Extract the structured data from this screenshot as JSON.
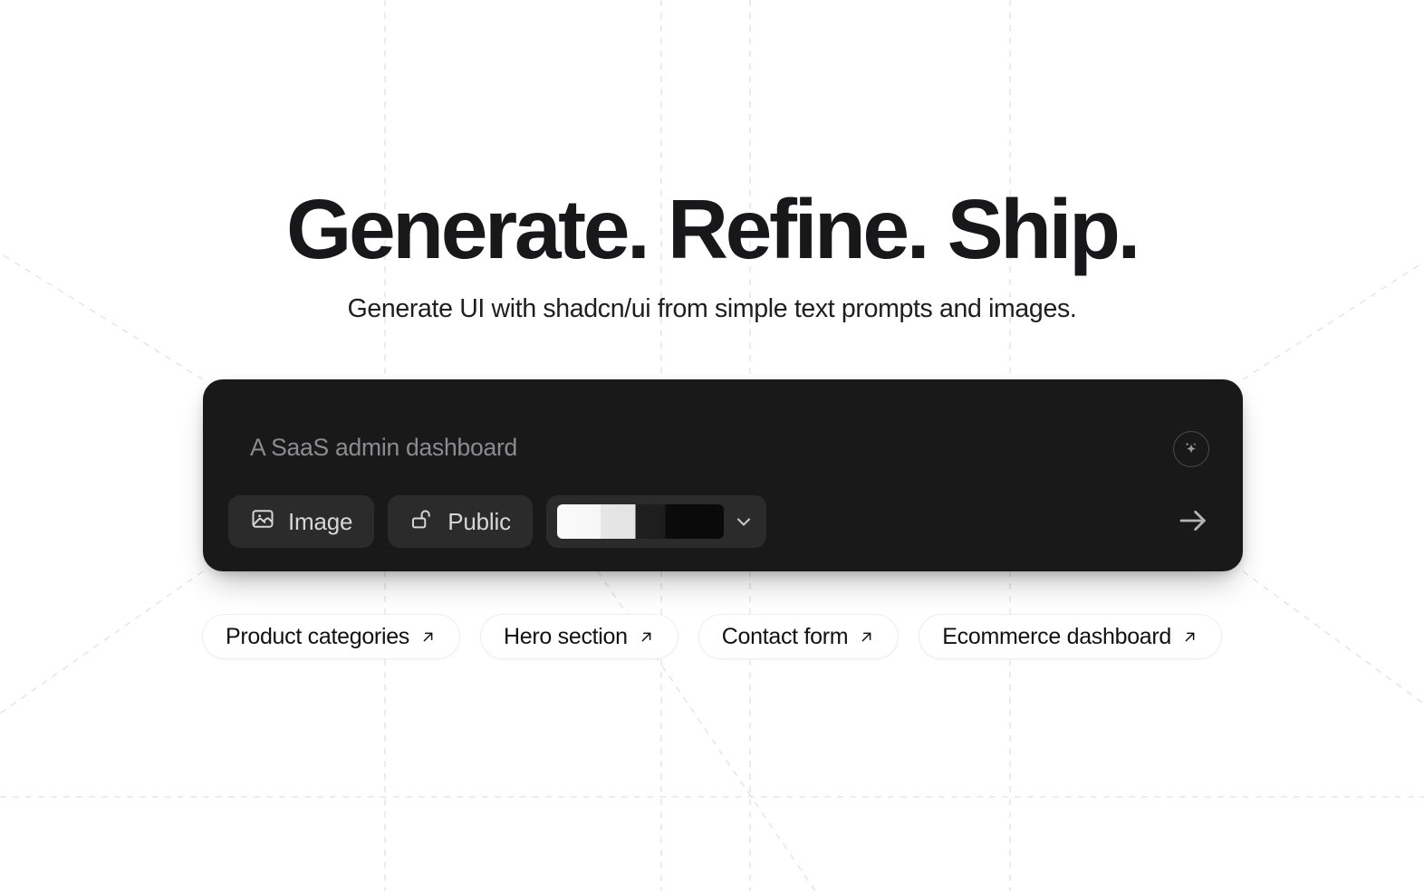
{
  "hero": {
    "title": "Generate. Refine. Ship.",
    "subtitle": "Generate UI with shadcn/ui from simple text prompts and images."
  },
  "composer": {
    "prompt_value": "A SaaS admin dashboard",
    "prompt_placeholder": "A SaaS admin dashboard",
    "enhance_icon": "sparkles-icon",
    "submit_icon": "arrow-right-icon",
    "background_color": "#191919",
    "pill_background_color": "#2b2b2b",
    "text_color": "#b6b6b9",
    "attachments": [
      {
        "label": "Image",
        "icon": "image-icon"
      },
      {
        "label": "Public",
        "icon": "unlock-icon"
      }
    ],
    "model_select": {
      "state": "loading",
      "value": "",
      "chevron_icon": "chevron-down-icon"
    }
  },
  "suggestions": {
    "arrow_icon": "arrow-up-right-icon",
    "items": [
      {
        "label": "Product categories"
      },
      {
        "label": "Hero section"
      },
      {
        "label": "Contact form"
      },
      {
        "label": "Ecommerce dashboard"
      }
    ]
  },
  "background": {
    "color": "#ffffff",
    "guide_color": "#e3e3e3",
    "vertical_guides": [
      425,
      730,
      828,
      1115
    ],
    "horizontal_guides": [
      880
    ]
  }
}
